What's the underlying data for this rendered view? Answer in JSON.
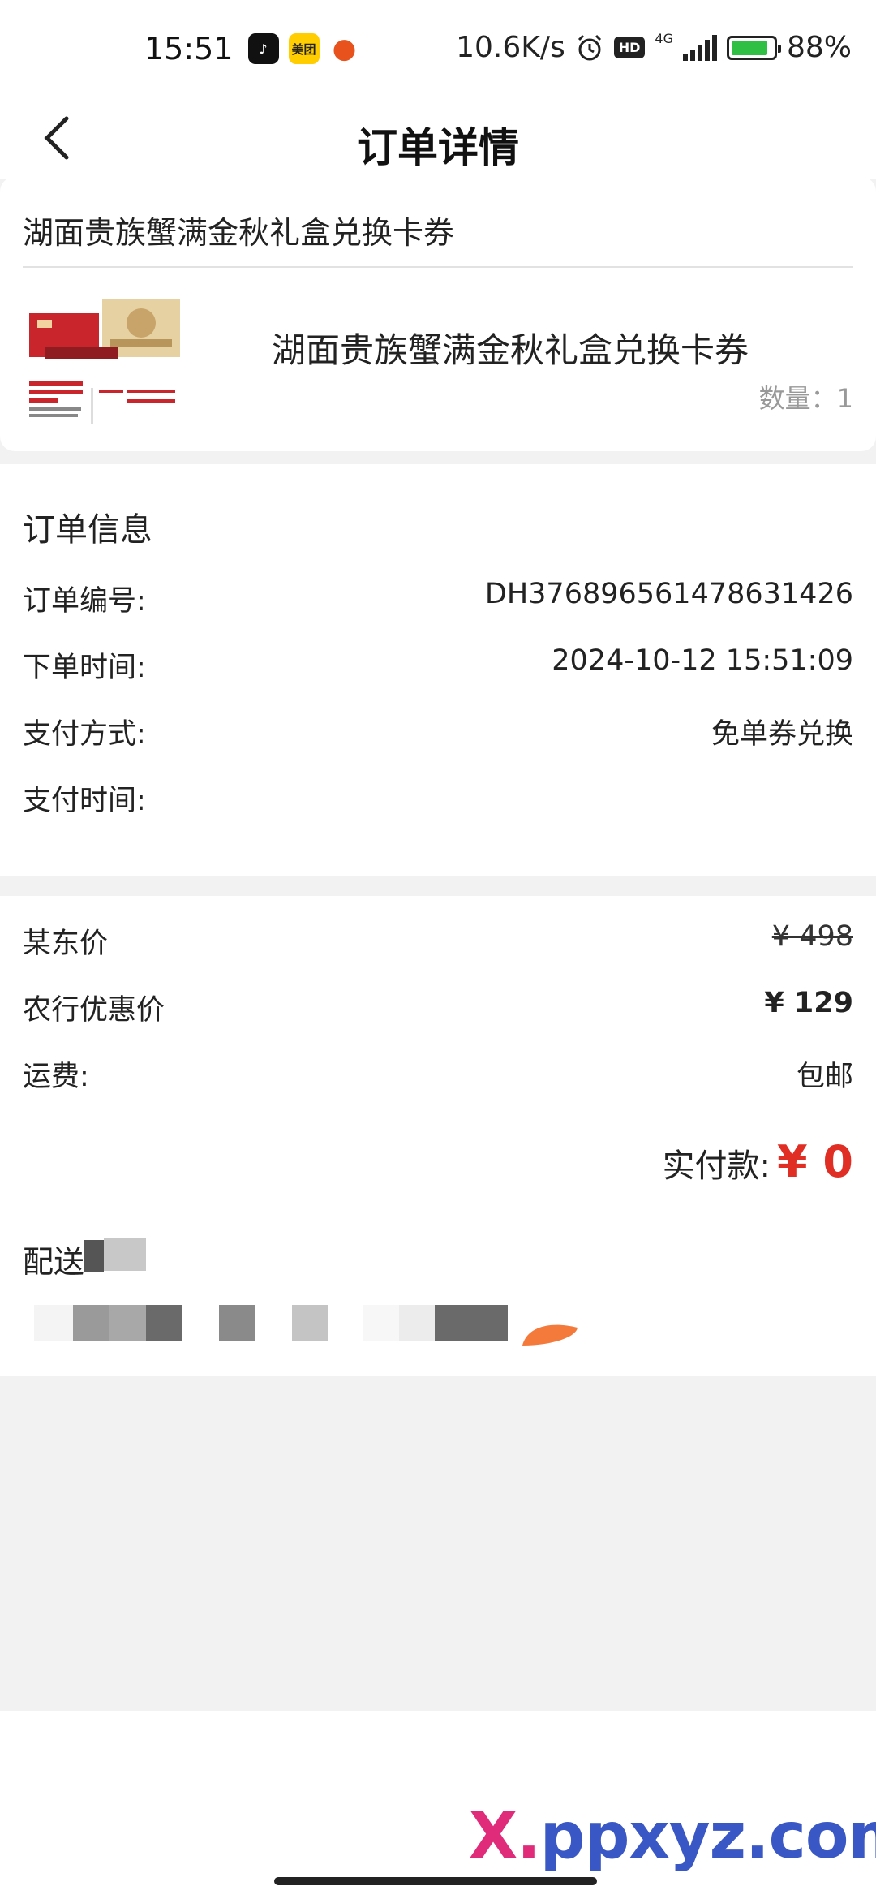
{
  "status_bar": {
    "time": "15:51",
    "network_speed": "10.6K/s",
    "network_type": "4G",
    "hd": "HD",
    "battery": "88%",
    "battery_level": 0.88,
    "icons": [
      "douyin-app-icon",
      "meituan-app-icon",
      "fox-app-icon",
      "alarm-icon",
      "signal-icon",
      "battery-icon"
    ]
  },
  "nav": {
    "title": "订单详情",
    "back_icon": "chevron-left-icon"
  },
  "product": {
    "header": "湖面贵族蟹满金秋礼盒兑换卡券",
    "name": "湖面贵族蟹满金秋礼盒兑换卡券",
    "quantity": "数量：1"
  },
  "order_info": {
    "title": "订单信息",
    "rows": [
      {
        "label": "订单编号:",
        "value": "DH376896561478631426"
      },
      {
        "label": "下单时间:",
        "value": "2024-10-12 15:51:09"
      },
      {
        "label": "支付方式:",
        "value": "免单券兑换"
      },
      {
        "label": "支付时间:",
        "value": ""
      }
    ]
  },
  "pricing": {
    "rows": [
      {
        "label": "某东价",
        "value": "¥ 498"
      },
      {
        "label": "农行优惠价",
        "value": "¥ 129"
      },
      {
        "label": "运费:",
        "value": "包邮"
      }
    ],
    "total_label": "实付款:",
    "total_amount": "¥ 0"
  },
  "delivery": {
    "title": "配送"
  },
  "watermark": {
    "x": "X.",
    "rest": "ppxyz.com"
  },
  "colors": {
    "accent_red": "#e02e24",
    "background": "#f2f2f2"
  }
}
